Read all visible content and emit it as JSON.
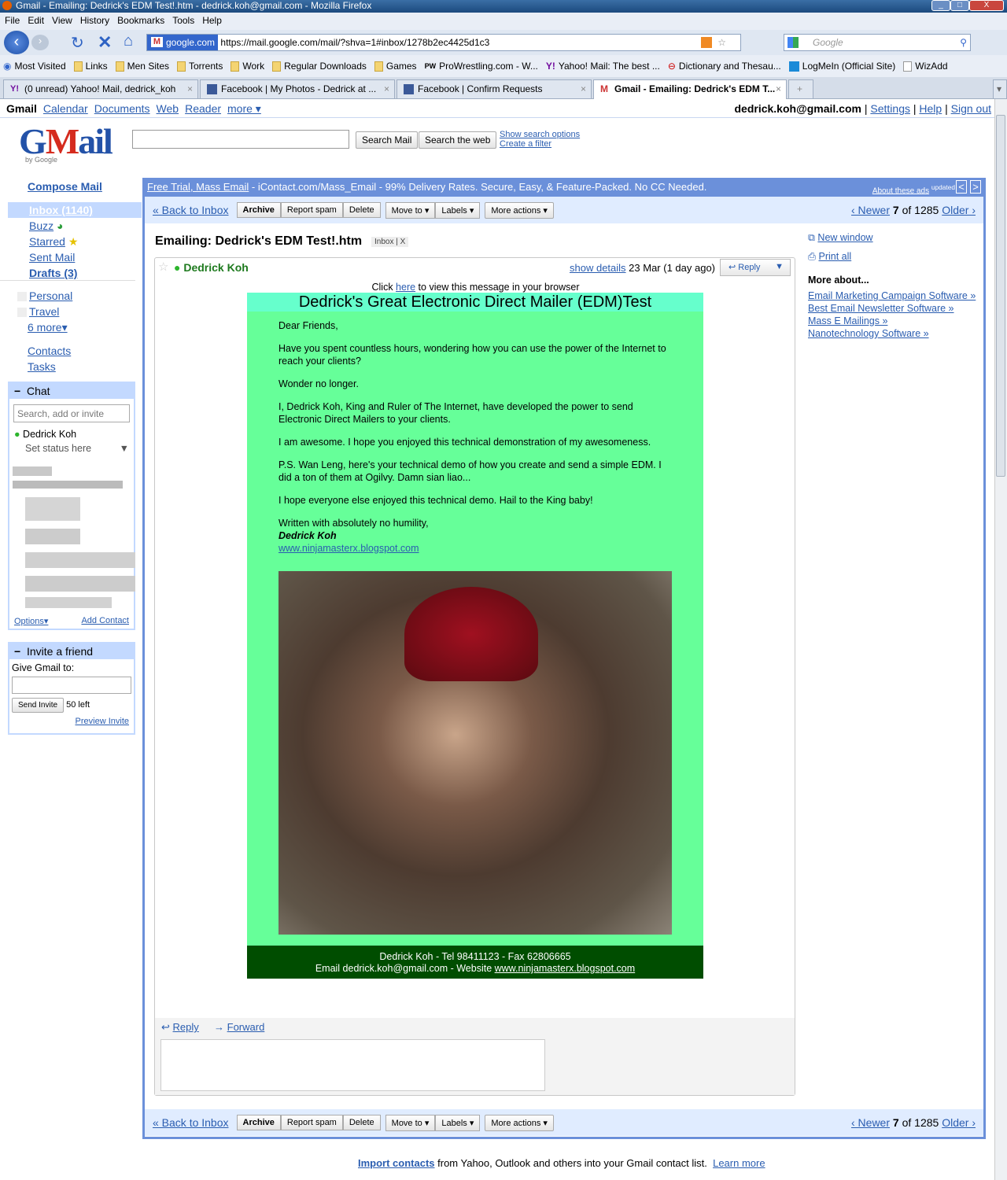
{
  "window": {
    "title": "Gmail - Emailing: Dedrick's EDM Test!.htm - dedrick.koh@gmail.com - Mozilla Firefox"
  },
  "menu": [
    "File",
    "Edit",
    "View",
    "History",
    "Bookmarks",
    "Tools",
    "Help"
  ],
  "url": {
    "site": "google.com",
    "address": "https://mail.google.com/mail/?shva=1#inbox/1278b2ec4425d1c3"
  },
  "search": {
    "placeholder": "Google"
  },
  "bookmarks": [
    "Most Visited",
    "Links",
    "Men Sites",
    "Torrents",
    "Work",
    "Regular Downloads",
    "Games",
    "ProWrestling.com - W...",
    "Yahoo! Mail: The best ...",
    "Dictionary and Thesau...",
    "LogMeIn (Official Site)",
    "WizAdd"
  ],
  "tabs": [
    "(0 unread) Yahoo! Mail, dedrick_koh",
    "Facebook | My Photos - Dedrick at ...",
    "Facebook | Confirm Requests",
    "Gmail - Emailing: Dedrick's EDM T..."
  ],
  "gbar": {
    "items": [
      "Gmail",
      "Calendar",
      "Documents",
      "Web",
      "Reader",
      "more ▾"
    ],
    "user": "dedrick.koh@gmail.com",
    "settings": "Settings",
    "help": "Help",
    "signout": "Sign out"
  },
  "gsearch": {
    "search_mail": "Search Mail",
    "search_web": "Search the web",
    "show_options": "Show search options",
    "create_filter": "Create a filter"
  },
  "logo": "Gmail by Google",
  "nav": {
    "compose": "Compose Mail",
    "inbox": "Inbox (1140)",
    "buzz": "Buzz",
    "starred": "Starred",
    "sent": "Sent Mail",
    "drafts": "Drafts (3)",
    "labels": [
      "Personal",
      "Travel"
    ],
    "more": "6 more▾",
    "contacts": "Contacts",
    "tasks": "Tasks"
  },
  "chat": {
    "title": "Chat",
    "placeholder": "Search, add or invite",
    "me": "Dedrick Koh",
    "status": "Set status here",
    "options": "Options▾",
    "add": "Add Contact"
  },
  "invite": {
    "title": "Invite a friend",
    "label": "Give Gmail to:",
    "send": "Send Invite",
    "left": "50 left",
    "preview": "Preview Invite"
  },
  "ad": {
    "link": "Free Trial, Mass Email",
    "text": " - iContact.com/Mass_Email - 99% Delivery Rates. Secure, Easy, & Feature-Packed. No CC Needed.",
    "about": "About these ads",
    "updated": "updated"
  },
  "toolbar": {
    "back": "« Back to Inbox",
    "archive": "Archive",
    "spam": "Report spam",
    "delete": "Delete",
    "move": "Move to ▾",
    "labels": "Labels ▾",
    "more": "More actions ▾",
    "newer": "‹ Newer",
    "count": "7",
    "of": "of 1285",
    "older": "Older ›"
  },
  "message": {
    "subject": "Emailing: Dedrick's EDM Test!.htm",
    "label": "Inbox",
    "sender": "Dedrick Koh",
    "details": "show details",
    "date": "23 Mar (1 day ago)",
    "reply": "Reply",
    "click_pre": "Click ",
    "click_link": "here",
    "click_post": " to view this message in your browser",
    "edm_title": "Dedrick's Great Electronic Direct Mailer (EDM)Test",
    "paras": [
      "Dear Friends,",
      "Have you spent countless hours, wondering how you can use the power of the Internet to reach your clients?",
      "Wonder no longer.",
      "I, Dedrick Koh, King and Ruler of The Internet, have developed the power to send Electronic Direct Mailers to your clients.",
      "I am awesome. I hope you enjoyed this technical demonstration of my awesomeness.",
      "P.S. Wan Leng, here's your technical demo of how you create and send a simple EDM. I did a ton of them at Ogilvy. Damn sian liao...",
      "I hope everyone else enjoyed this technical demo. Hail to the King baby!"
    ],
    "signoff": "Written with absolutely no humility,",
    "signature": "Dedrick Koh",
    "site": "www.ninjamasterx.blogspot.com",
    "footer1": "Dedrick Koh - Tel 98411123 - Fax 62806665",
    "footer2_pre": "Email dedrick.koh@gmail.com - Website ",
    "footer2_link": "www.ninjamasterx.blogspot.com",
    "reply_link": "Reply",
    "forward_link": "Forward"
  },
  "side": {
    "new_window": "New window",
    "print": "Print all",
    "more_about": "More about...",
    "links": [
      "Email Marketing Campaign Software »",
      "Best Email Newsletter Software »",
      "Mass E Mailings »",
      "Nanotechnology Software »"
    ]
  },
  "bottom": {
    "import": "Import contacts",
    "text": " from Yahoo, Outlook and others into your Gmail contact list.  ",
    "learn": "Learn more"
  }
}
